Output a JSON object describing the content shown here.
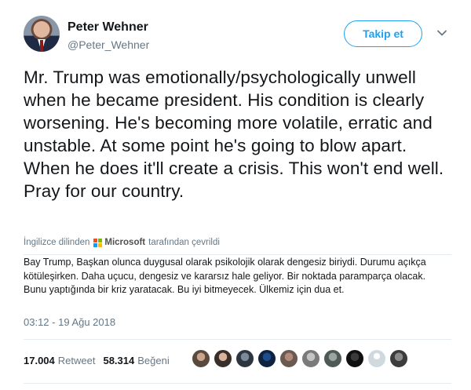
{
  "user": {
    "name": "Peter Wehner",
    "handle": "@Peter_Wehner"
  },
  "follow_button": {
    "label": "Takip et"
  },
  "tweet": {
    "text": "Mr. Trump was emotionally/psychologically unwell when he became president. His condition is clearly worsening. He's becoming more volatile, erratic and unstable. At some point he's going to blow apart. When he does it'll create a crisis. This won't end well. Pray for our country."
  },
  "translation": {
    "prefix": "İngilizce dilinden",
    "provider": "Microsoft",
    "suffix": "tarafından çevrildi",
    "text": "Bay Trump, Başkan olunca duygusal olarak psikolojik olarak dengesiz biriydi. Durumu açıkça kötüleşirken. Daha uçucu, dengesiz ve kararsız hale geliyor. Bir noktada paramparça olacak. Bunu yaptığında bir kriz yaratacak. Bu iyi bitmeyecek. Ülkemiz için dua et."
  },
  "timestamp": "03:12 - 19 Ağu 2018",
  "stats": {
    "retweets": "17.004",
    "retweets_label": "Retweet",
    "likes": "58.314",
    "likes_label": "Beğeni"
  },
  "liker_avatars": [
    "liker-avatar",
    "liker-avatar",
    "liker-avatar",
    "liker-avatar",
    "liker-avatar",
    "liker-avatar",
    "liker-avatar",
    "liker-avatar",
    "liker-avatar",
    "liker-avatar"
  ],
  "colors": {
    "accent": "#1da1f2",
    "secondary_text": "#657786",
    "microsoft_logo": [
      "#f25022",
      "#7fba00",
      "#00a4ef",
      "#ffb900"
    ]
  }
}
